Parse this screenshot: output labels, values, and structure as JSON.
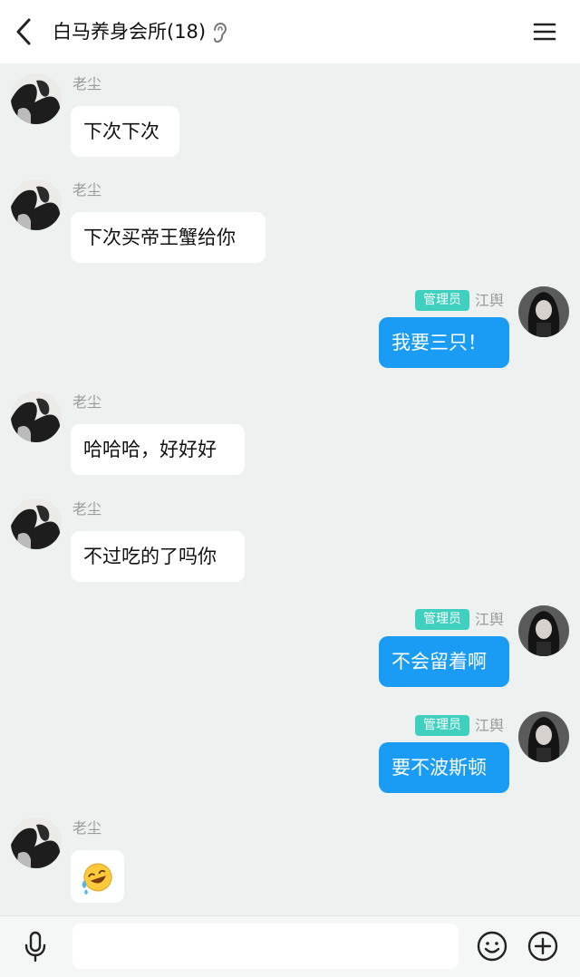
{
  "header": {
    "title": "白马养身会所(18)"
  },
  "messages": [
    {
      "side": "left",
      "sender": "老尘",
      "text": "下次下次"
    },
    {
      "side": "left",
      "sender": "老尘",
      "text": "下次买帝王蟹给你"
    },
    {
      "side": "right",
      "sender": "江舆",
      "role": "管理员",
      "text": "我要三只！"
    },
    {
      "side": "left",
      "sender": "老尘",
      "text": "哈哈哈，好好好"
    },
    {
      "side": "left",
      "sender": "老尘",
      "text": "不过吃的了吗你"
    },
    {
      "side": "right",
      "sender": "江舆",
      "role": "管理员",
      "text": "不会留着啊"
    },
    {
      "side": "right",
      "sender": "江舆",
      "role": "管理员",
      "text": "要不波斯顿"
    },
    {
      "side": "left",
      "sender": "老尘",
      "sticker": "laughing-tears-emoji"
    }
  ],
  "input": {
    "value": ""
  },
  "colors": {
    "self_bubble": "#1a9cf5",
    "admin_badge": "#3fd0bf",
    "chat_background": "#edf1ef"
  },
  "icons": [
    "back-arrow-icon",
    "ear-icon",
    "menu-icon",
    "mic-icon",
    "smile-icon",
    "plus-icon"
  ]
}
